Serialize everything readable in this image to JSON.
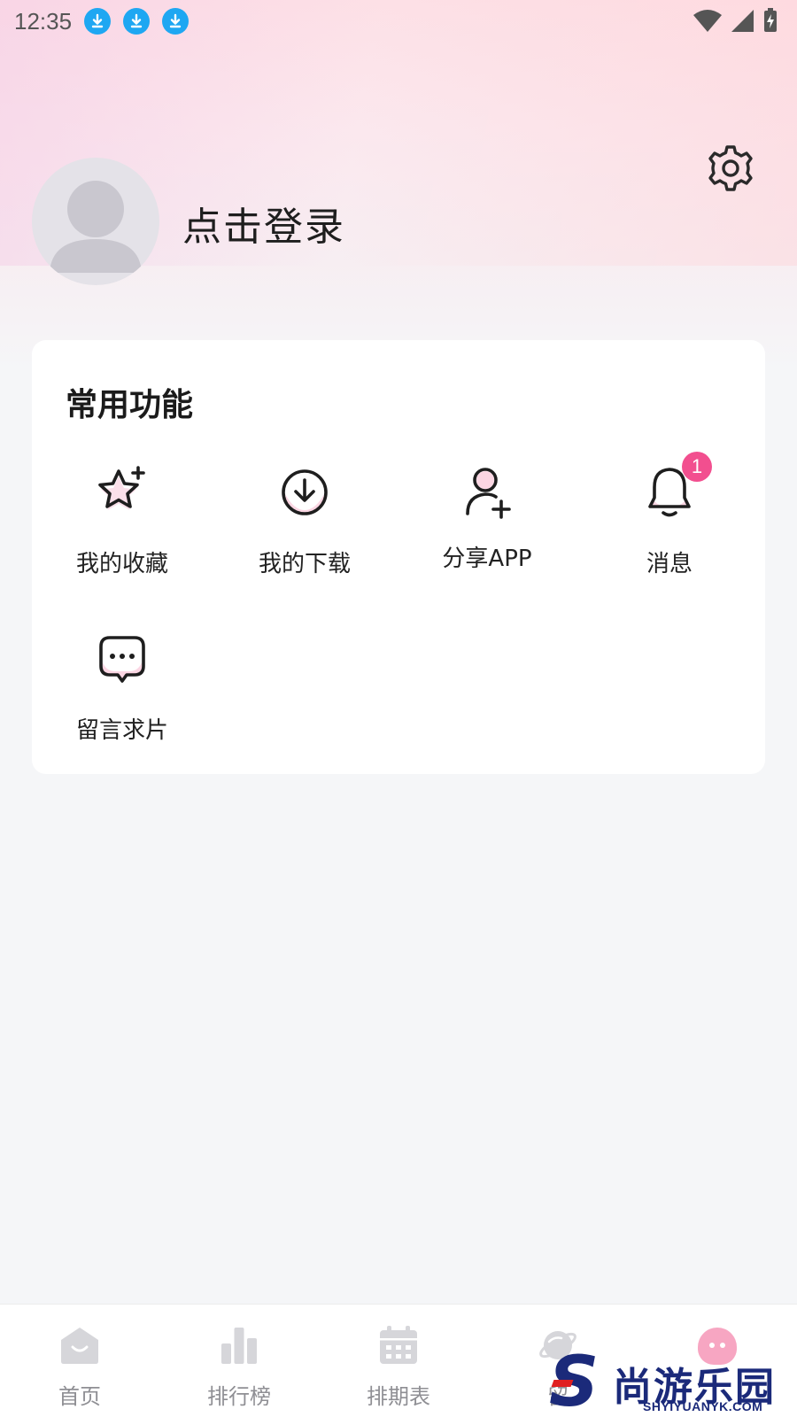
{
  "status_bar": {
    "time": "12:35",
    "download_icons": [
      "download-icon",
      "download-icon",
      "download-icon"
    ],
    "right_icons": [
      "wifi-icon",
      "signal-icon",
      "battery-charging-icon"
    ]
  },
  "profile": {
    "login_text": "点击登录",
    "avatar_icon": "default-avatar-icon",
    "settings_icon": "gear-icon"
  },
  "functions": {
    "title": "常用功能",
    "items": [
      {
        "label": "我的收藏",
        "icon": "star-plus-icon"
      },
      {
        "label": "我的下载",
        "icon": "download-circle-icon"
      },
      {
        "label": "分享APP",
        "icon": "user-plus-icon"
      },
      {
        "label": "消息",
        "icon": "bell-icon",
        "badge": "1"
      },
      {
        "label": "留言求片",
        "icon": "chat-bubble-icon"
      }
    ]
  },
  "bottom_nav": {
    "items": [
      {
        "label": "首页",
        "icon": "home-icon"
      },
      {
        "label": "排行榜",
        "icon": "bar-chart-icon"
      },
      {
        "label": "排期表",
        "icon": "calendar-icon"
      },
      {
        "label": "留",
        "icon": "planet-icon"
      },
      {
        "label": "",
        "icon": "mine-icon"
      }
    ]
  },
  "watermark": {
    "letter": "S",
    "chinese": "尚游乐园",
    "url": "SHYIYUANYK.COM"
  },
  "colors": {
    "accent_pink": "#f24f8f",
    "download_blue": "#1ea7f2",
    "nav_gray": "#8f8f94"
  }
}
